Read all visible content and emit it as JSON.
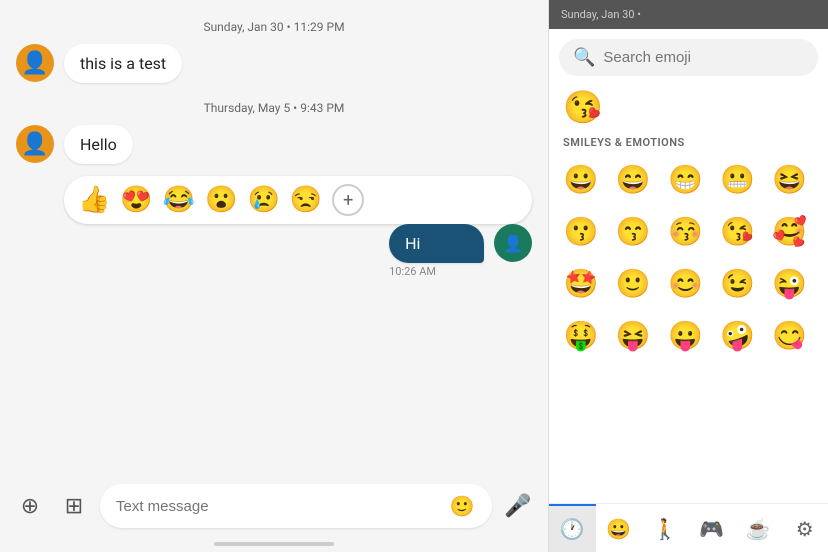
{
  "chat": {
    "messages": [
      {
        "id": "msg1",
        "date": "Sunday, Jan 30 • 11:29 PM",
        "text": "this is a test",
        "sender": "other"
      },
      {
        "id": "msg2",
        "date": "Thursday, May 5 • 9:43 PM",
        "text": "Hello",
        "sender": "other"
      },
      {
        "id": "msg3",
        "text": "Hi",
        "sender": "self",
        "time": "10:26 AM"
      }
    ],
    "reactions": [
      "👍",
      "😍",
      "😂",
      "😮",
      "😢",
      "😒"
    ],
    "input_placeholder": "Text message"
  },
  "emoji_picker": {
    "header_date": "Sunday, Jan 30 •",
    "search_placeholder": "Search emoji",
    "featured_emoji": "😘",
    "section_label": "SMILEYS & EMOTIONS",
    "emojis_row1": [
      "😀",
      "😄",
      "😁",
      "😬",
      "😆"
    ],
    "emojis_row2": [
      "😗",
      "😙",
      "😚",
      "😘",
      "🥰"
    ],
    "emojis_row3": [
      "🤩",
      "🙂",
      "😊",
      "😉",
      "😜"
    ],
    "emojis_row4": [
      "🤑",
      "😝",
      "😛",
      "🤪",
      "😋"
    ],
    "tabs": [
      {
        "icon": "🕐",
        "label": "recent",
        "active": true
      },
      {
        "icon": "😀",
        "label": "smileys",
        "active": false
      },
      {
        "icon": "🚶",
        "label": "people",
        "active": false
      },
      {
        "icon": "🎮",
        "label": "activities",
        "active": false
      },
      {
        "icon": "☕",
        "label": "objects",
        "active": false
      },
      {
        "icon": "⚙",
        "label": "symbols",
        "active": false
      }
    ]
  }
}
